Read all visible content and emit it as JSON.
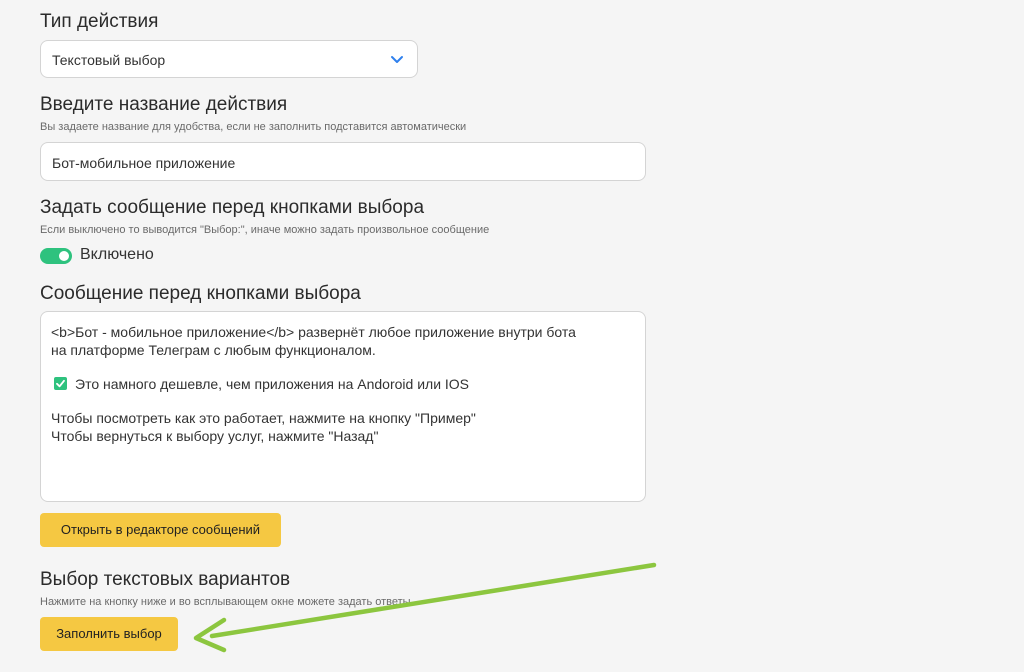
{
  "action_type": {
    "title": "Тип действия",
    "value": "Текстовый выбор"
  },
  "action_name": {
    "title": "Введите название действия",
    "hint": "Вы задаете название для удобства, если не заполнить подставится автоматически",
    "value": "Бот-мобильное приложение"
  },
  "pre_message": {
    "title": "Задать сообщение перед кнопками выбора",
    "hint": "Если выключено то выводится \"Выбор:\", иначе можно задать произвольное сообщение",
    "toggle_label": "Включено",
    "toggle_on": true
  },
  "message": {
    "title": "Сообщение перед кнопками выбора",
    "lines": [
      "<b>Бот - мобильное приложение</b> развернёт любое приложение внутри бота",
      "на платформе Телеграм с любым функционалом.",
      "Это намного дешевле, чем приложения на Andoroid или IOS",
      "Чтобы посмотреть как это работает, нажмите на кнопку \"Пример\"",
      "Чтобы вернуться к выбору услуг, нажмите \"Назад\""
    ],
    "open_editor_label": "Открыть в редакторе сообщений"
  },
  "text_variants": {
    "title": "Выбор текстовых вариантов",
    "hint": "Нажмите на кнопку ниже и во всплывающем окне можете задать ответы",
    "fill_label": "Заполнить выбор"
  },
  "colors": {
    "accent_yellow": "#f5c842",
    "toggle_green": "#2ec27e",
    "arrow_green": "#8cc63f",
    "chevron_blue": "#2f80ed"
  },
  "icons": {
    "dropdown": "chevron-down-icon",
    "checkbox": "check-box-icon",
    "annotation": "arrow-icon"
  }
}
